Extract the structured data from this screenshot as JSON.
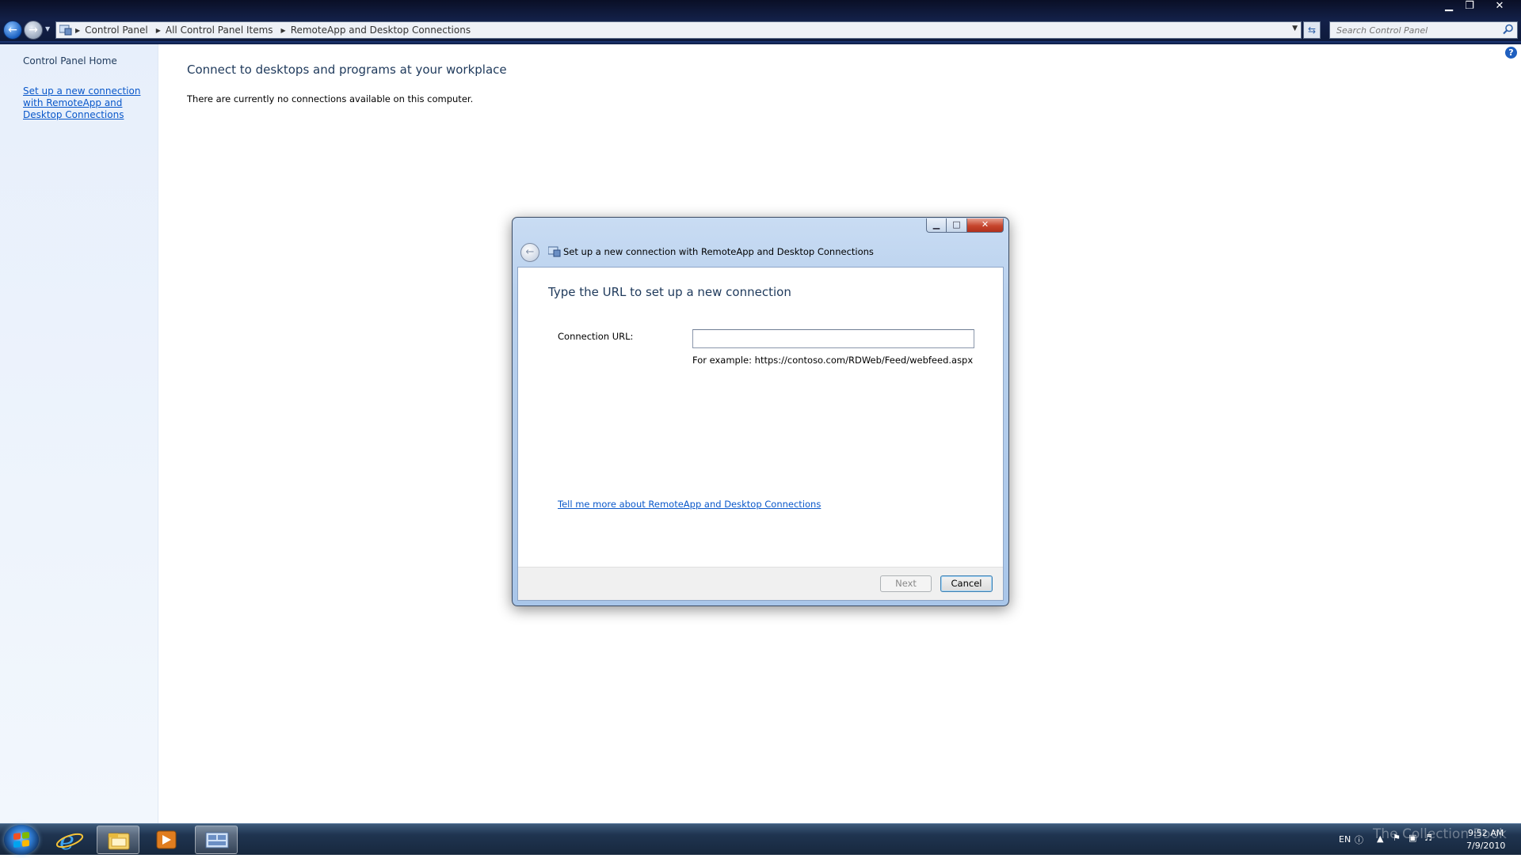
{
  "window": {
    "minimize_glyph": "▁",
    "restore_glyph": "❐",
    "close_glyph": "✕"
  },
  "address_bar": {
    "breadcrumbs": [
      "Control Panel",
      "All Control Panel Items",
      "RemoteApp and Desktop Connections"
    ],
    "search_placeholder": "Search Control Panel"
  },
  "left_pane": {
    "home_label": "Control Panel Home",
    "setup_link": "Set up a new connection with RemoteApp and Desktop Connections"
  },
  "main": {
    "title": "Connect to desktops and programs at your workplace",
    "message": "There are currently no connections available on this computer.",
    "help_glyph": "?"
  },
  "dialog": {
    "title": "Set up a new connection with RemoteApp and Desktop Connections",
    "heading": "Type the URL to set up a new connection",
    "url_label": "Connection URL:",
    "url_value": "",
    "url_example": "For example: https://contoso.com/RDWeb/Feed/webfeed.aspx",
    "tell_more_link": "Tell me more about RemoteApp and Desktop Connections",
    "next_label": "Next",
    "cancel_label": "Cancel"
  },
  "taskbar": {
    "apps": [
      "internet-explorer-icon",
      "windows-explorer-icon",
      "media-player-icon",
      "control-panel-icon"
    ],
    "language": "EN",
    "time": "9:52 AM",
    "date": "7/9/2010"
  },
  "watermark": "The Collection Book",
  "colors": {
    "link": "#0a58ca",
    "heading": "#1e395b",
    "left_pane_bg": "#e7effb",
    "taskbar_bg": "#1f3450"
  }
}
